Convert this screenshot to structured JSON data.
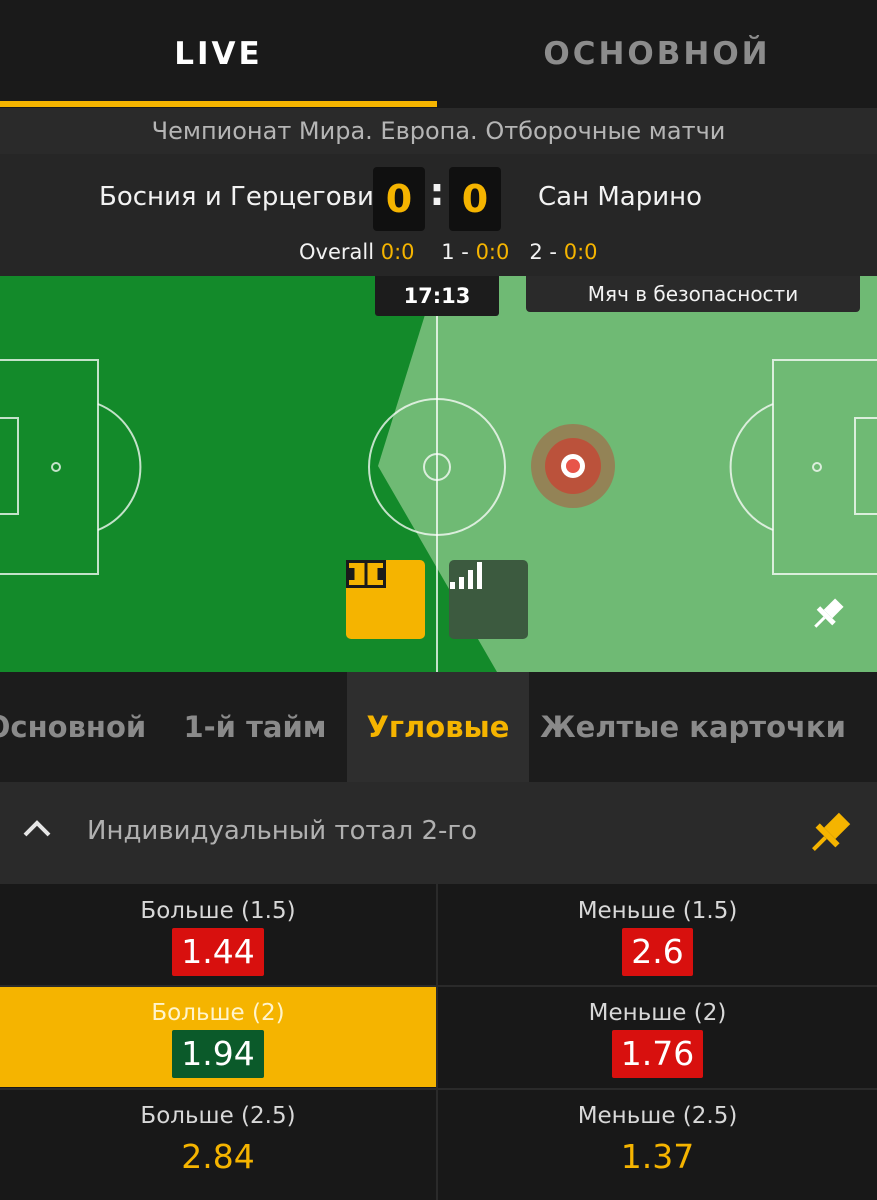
{
  "top_tabs": {
    "live": "LIVE",
    "main": "ОСНОВНОЙ"
  },
  "league": "Чемпионат Мира. Европа. Отборочные матчи",
  "match": {
    "home": "Босния и Герцеговина",
    "away": "Сан Марино",
    "home_score": "0",
    "away_score": "0",
    "separator": ":",
    "periods": {
      "overall_label": "Overall",
      "overall_value": "0:0",
      "p1_label": "1 -",
      "p1_value": "0:0",
      "p2_label": "2 -",
      "p2_value": "0:0"
    }
  },
  "pitch": {
    "clock": "17:13",
    "event": "Мяч в безопасности",
    "icons": [
      "field-view-icon",
      "stats-bars-icon",
      "pin-icon"
    ]
  },
  "market_tabs": [
    "Основной",
    "1-й тайм",
    "Угловые",
    "Желтые карточки"
  ],
  "active_market_tab": "Угловые",
  "section": {
    "title": "Индивидуальный тотал 2-го"
  },
  "odds": [
    {
      "label": "Больше (1.5)",
      "value": "1.44",
      "style": "red"
    },
    {
      "label": "Меньше (1.5)",
      "value": "2.6",
      "style": "red"
    },
    {
      "label": "Больше (2)",
      "value": "1.94",
      "style": "green",
      "selected": true
    },
    {
      "label": "Меньше (2)",
      "value": "1.76",
      "style": "red"
    },
    {
      "label": "Больше (2.5)",
      "value": "2.84",
      "style": "plain"
    },
    {
      "label": "Меньше (2.5)",
      "value": "1.37",
      "style": "plain"
    }
  ],
  "colors": {
    "accent": "#f5b400",
    "pitch_dark": "#138a2a",
    "pitch_light": "#6fba74",
    "odds_down": "#d8100e",
    "odds_up": "#0b5a2a"
  }
}
